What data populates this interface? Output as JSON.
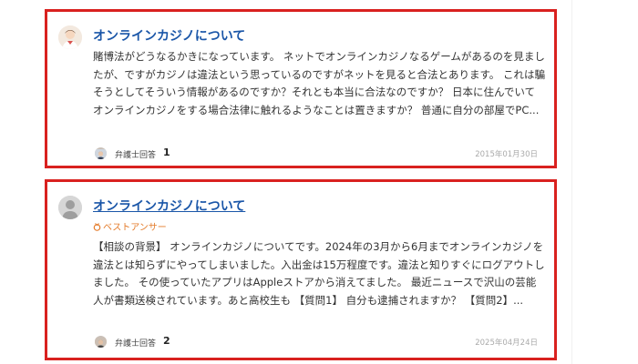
{
  "questions": [
    {
      "title": "オンラインカジノについて",
      "best_answer": "",
      "body": "賭博法がどうなるかきになっています。 ネットでオンラインカジノなるゲームがあるのを見ましたが、ですがカジノは違法という思っているのですがネットを見ると合法とあります。 これは騙そうとしてそういう情報があるのですか？それとも本当に合法なのですか？ 日本に住んでいてオンラインカジノをする場合法律に触れるようなことは置きますか？ 普通に自分の部屋でPC...",
      "lawyer_label": "弁護士回答",
      "answer_count": "1",
      "date": "2015年01月30日"
    },
    {
      "title": "オンラインカジノについて",
      "best_answer": "ベストアンサー",
      "body": "【相談の背景】 オンラインカジノについてです。2024年の3月から6月までオンラインカジノを違法とは知らずにやってしまいました。入出金は15万程度です。違法と知りすぐにログアウトしました。 その使っていたアプリはAppleストアから消えてました。 最近ニュースで沢山の芸能人が書類送検されています。あと高校生も 【質問1】 自分も逮捕されますか？ 【質問2】...",
      "lawyer_label": "弁護士回答",
      "answer_count": "2",
      "date": "2025年04月24日"
    }
  ],
  "colors": {
    "card_border": "#d9211f",
    "title_link": "#1a56a8",
    "best_answer": "#e47b2a",
    "date": "#aaaaaa"
  },
  "icons": {
    "asker_avatar_1": "user-avatar-icon",
    "asker_avatar_2": "default-user-icon",
    "lawyer_avatar": "lawyer-avatar-icon",
    "best_answer": "medal-icon"
  }
}
